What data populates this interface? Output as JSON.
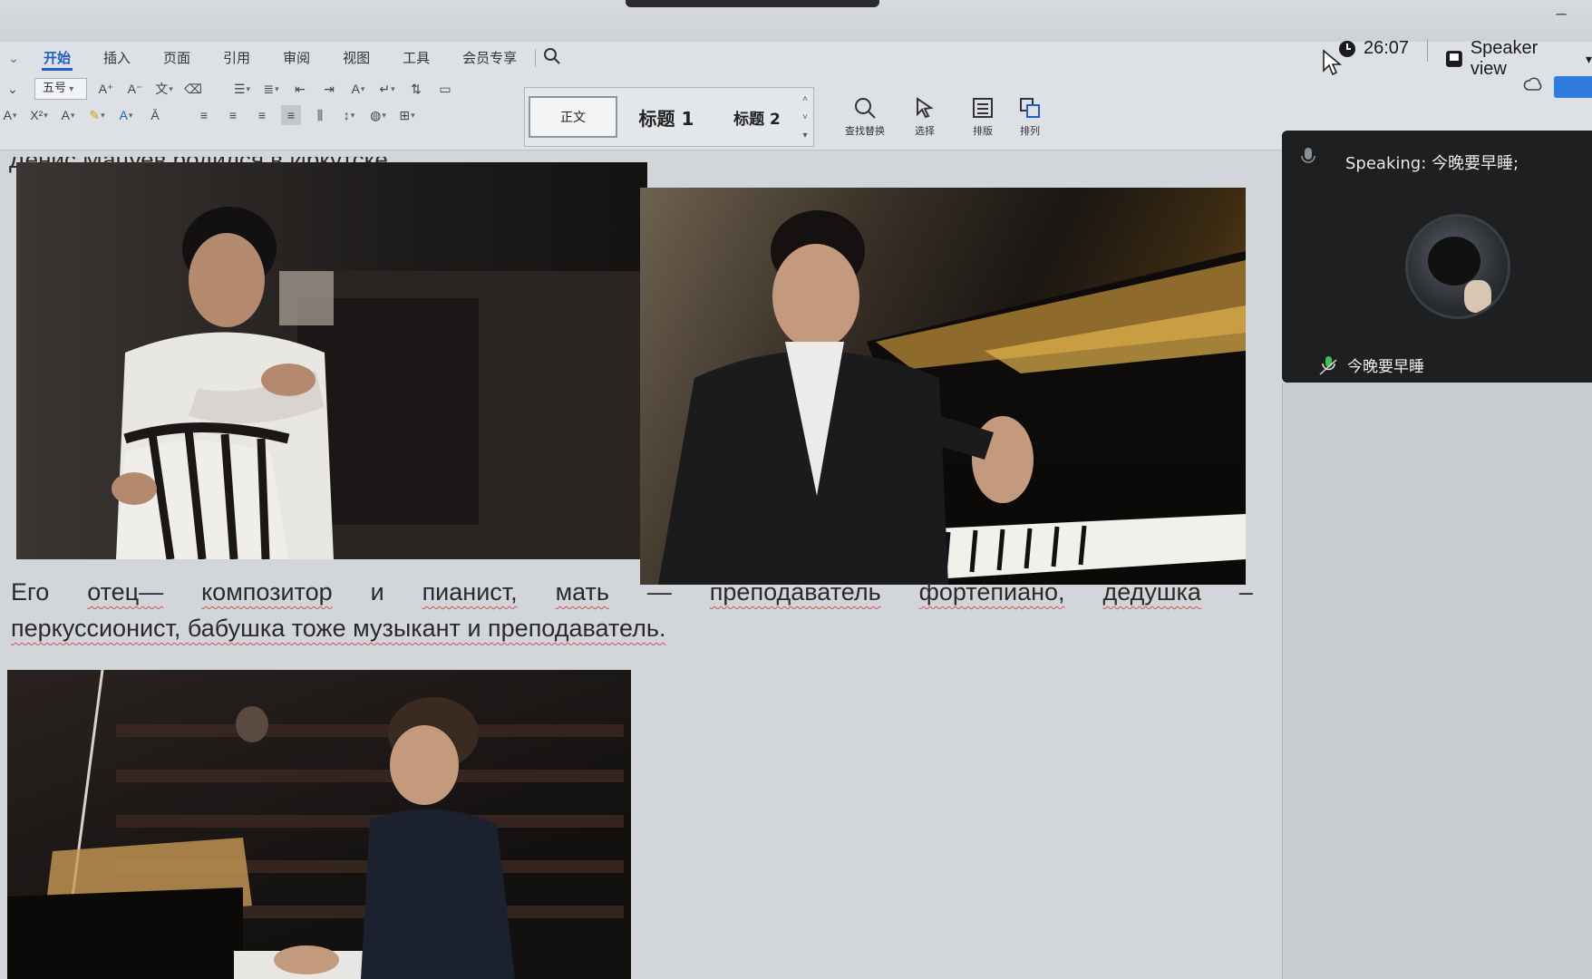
{
  "ribbon": {
    "tabs": [
      "开始",
      "插入",
      "页面",
      "引用",
      "审阅",
      "视图",
      "工具",
      "会员专享"
    ],
    "active_tab": "开始",
    "font_size": "五号",
    "styles": [
      "正文",
      "标题 1",
      "标题 2"
    ],
    "tools": [
      {
        "label": "查找替换",
        "icon": "search-icon"
      },
      {
        "label": "选择",
        "icon": "select-cursor-icon"
      },
      {
        "label": "排版",
        "icon": "layout-icon"
      },
      {
        "label": "排列",
        "icon": "arrange-icon"
      }
    ]
  },
  "meeting": {
    "timer": "26:07",
    "view_mode": "Speaker view",
    "speaking_label": "Speaking: 今晚要早睡;",
    "participant_name": "今晚要早睡"
  },
  "document": {
    "cut_line": "Денис Мацуев родился в Иркутске.",
    "paragraph_line1": [
      "Его",
      "отец—",
      "композитор",
      "и",
      "пианист,",
      "мать",
      "—",
      "преподаватель",
      "фортепиано,",
      "дедушка",
      "–"
    ],
    "paragraph_line2": "перкуссионист, бабушка тоже музыкант и преподаватель.",
    "images": [
      "photo-pianist-portrait",
      "photo-pianist-at-piano",
      "photo-pianist-playing"
    ]
  },
  "colors": {
    "accent": "#1f5fbf",
    "panel_bg": "#1e1f21",
    "spell_check": "#d4545b"
  }
}
